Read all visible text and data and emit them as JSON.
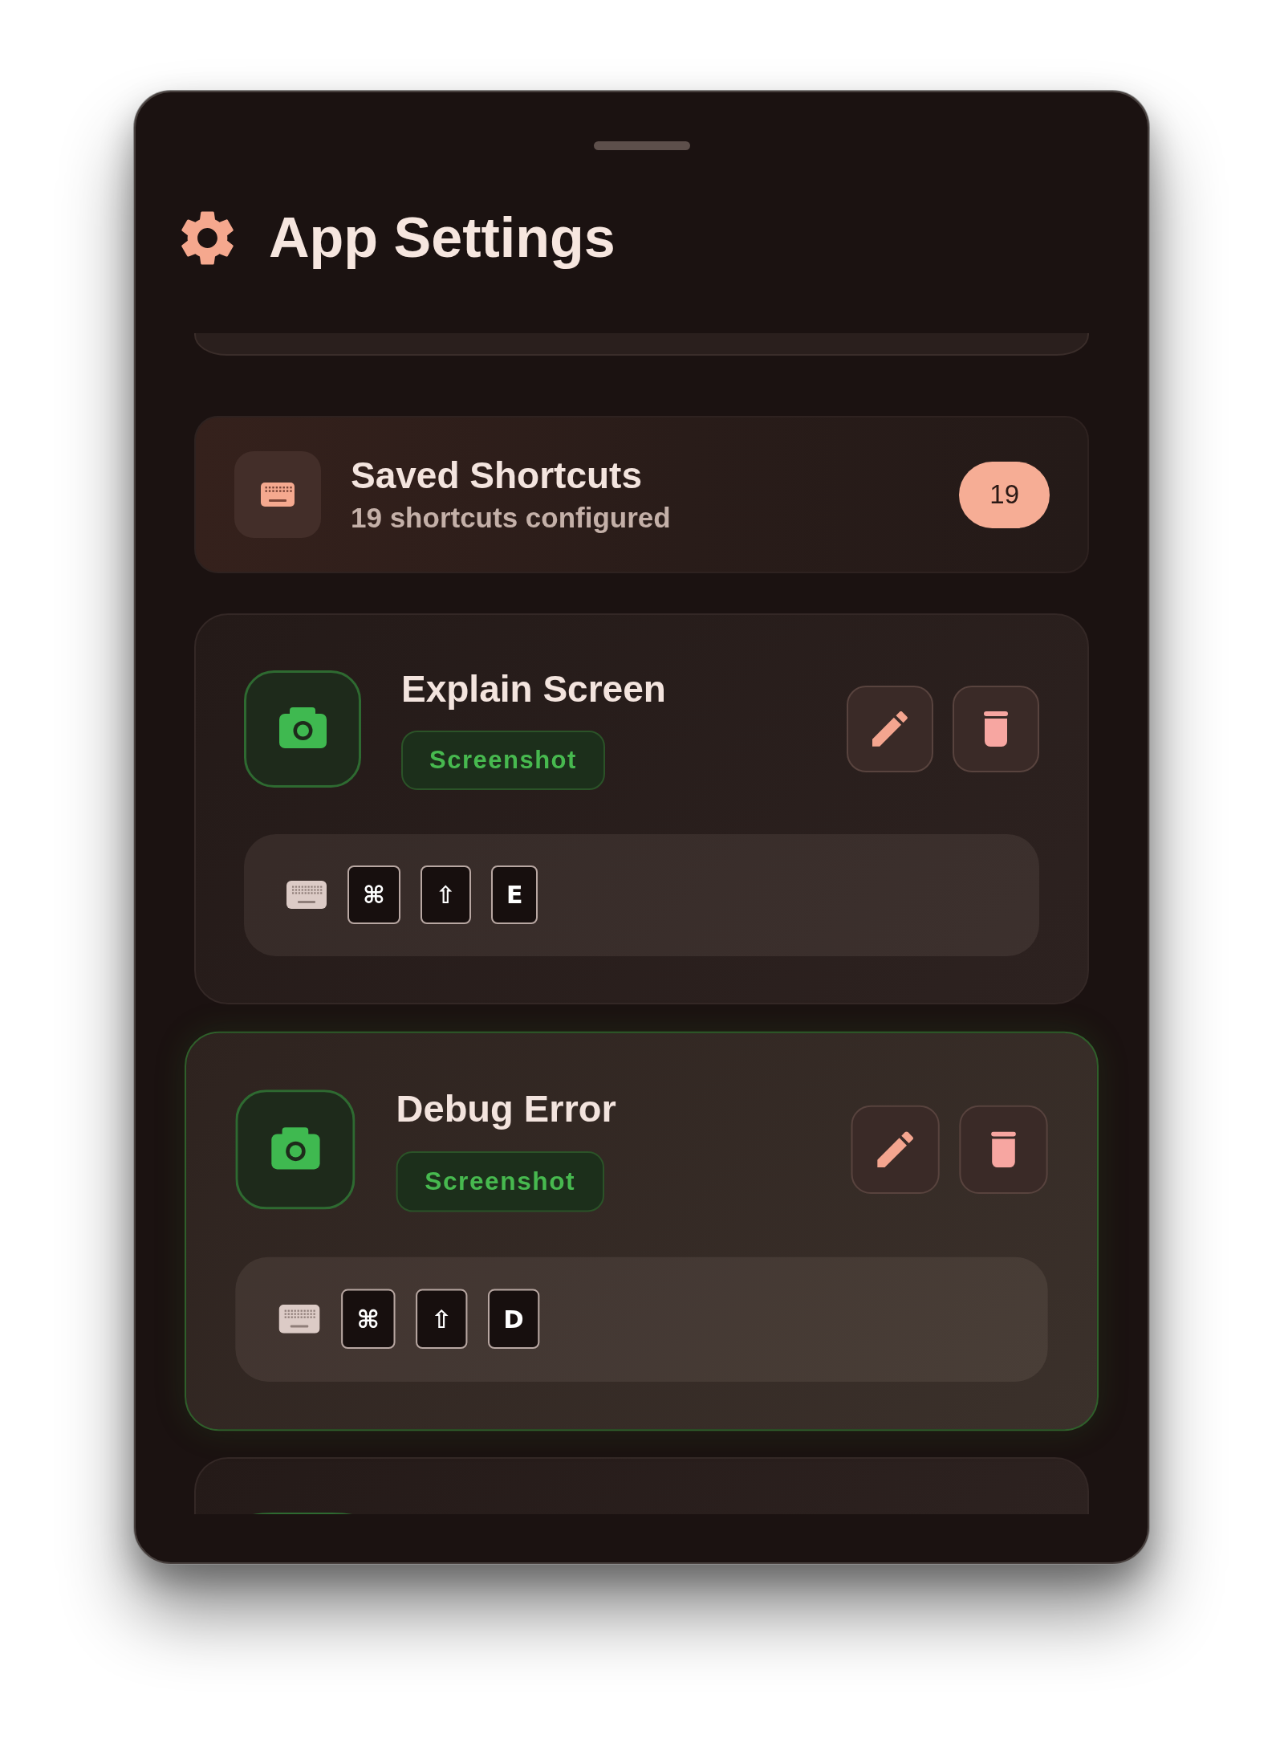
{
  "panel": {
    "title": "App Settings"
  },
  "summary": {
    "title": "Saved Shortcuts",
    "subtitle": "19 shortcuts configured",
    "count": "19"
  },
  "shortcuts": [
    {
      "title": "Explain Screen",
      "kind": "screenshot",
      "tag": "Screenshot",
      "selected": false,
      "keys": [
        "⌘",
        "⇧",
        "E"
      ]
    },
    {
      "title": "Debug Error",
      "kind": "screenshot",
      "tag": "Screenshot",
      "selected": true,
      "keys": [
        "⌘",
        "⇧",
        "D"
      ]
    },
    {
      "kind": "screenshot",
      "selected": false
    }
  ]
}
